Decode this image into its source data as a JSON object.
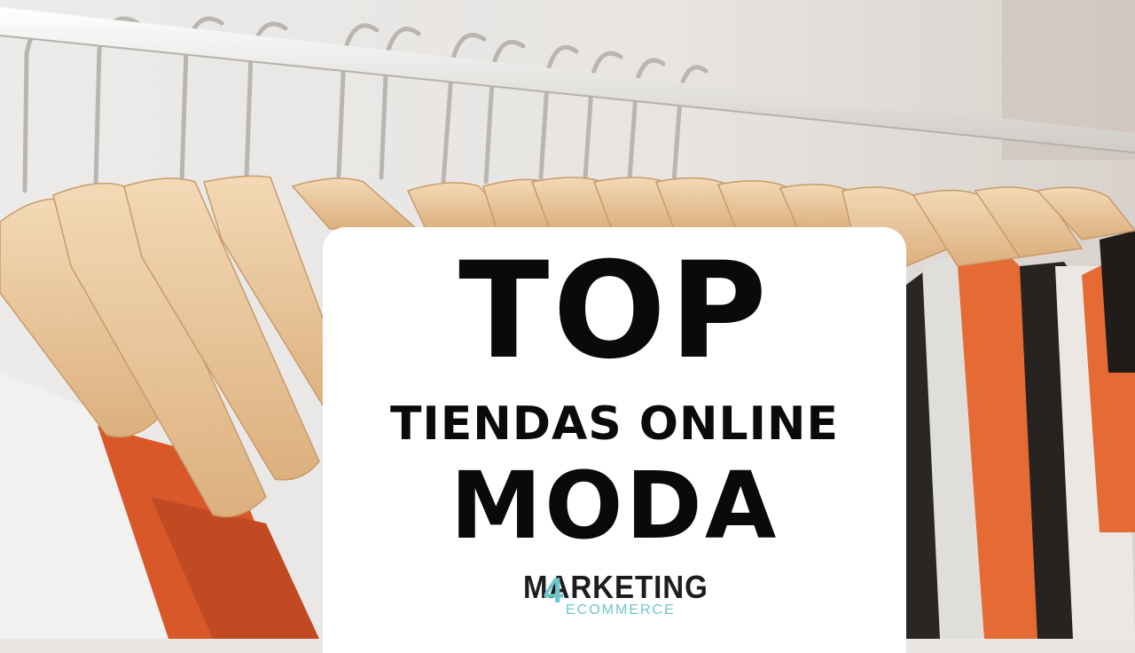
{
  "banner": {
    "line1": "TOP",
    "line2": "TIENDAS ONLINE",
    "line3": "MODA"
  },
  "logo": {
    "word": "MARKETING",
    "numeral": "4",
    "sub": "ECOMMERCE",
    "accent_color": "#6ec6cc"
  },
  "photo": {
    "subject": "wooden hangers with clothes on a rail",
    "colors": {
      "wood": "#e9c59c",
      "rail": "#f4f3f1",
      "shirt_orange": "#e66a33",
      "shirt_dark": "#262321"
    }
  }
}
